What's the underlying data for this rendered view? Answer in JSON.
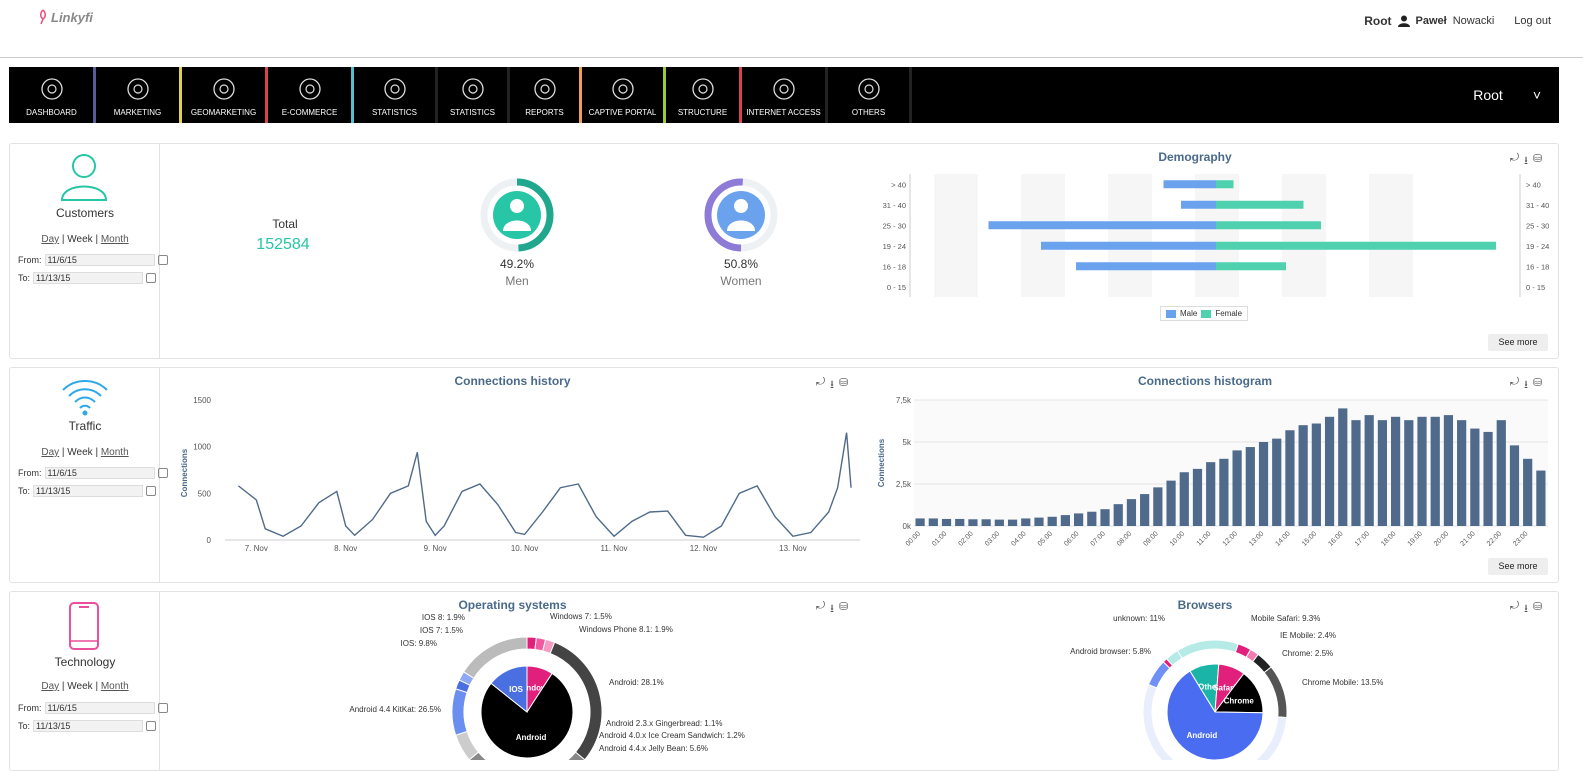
{
  "header": {
    "logo_text": "Linkyfi",
    "account": "Root",
    "user_first": "Paweł",
    "user_last": "Nowacki",
    "logout": "Log out"
  },
  "nav": {
    "items": [
      {
        "label": "DASHBOARD",
        "icon": "dashboard-icon",
        "color": "#5a5a9a"
      },
      {
        "label": "MARKETING",
        "icon": "target-icon",
        "color": "#e0d24a"
      },
      {
        "label": "GEOMARKETING",
        "icon": "globe-icon",
        "color": "#d9434d"
      },
      {
        "label": "E-COMMERCE",
        "icon": "shop-icon",
        "color": "#52c0d0"
      },
      {
        "label": "STATISTICS",
        "icon": "stats-icon",
        "color": "#222222"
      },
      {
        "label": "STATISTICS",
        "icon": "percent-icon",
        "color": "#222222"
      },
      {
        "label": "REPORTS",
        "icon": "reports-icon",
        "color": "#f0a050"
      },
      {
        "label": "CAPTIVE PORTAL",
        "icon": "cloud-icon",
        "color": "#9acd32"
      },
      {
        "label": "STRUCTURE",
        "icon": "users-icon",
        "color": "#d9434d"
      },
      {
        "label": "INTERNET ACCESS",
        "icon": "server-icon",
        "color": "#222222"
      },
      {
        "label": "OTHERS",
        "icon": "person-icon",
        "color": "#222222"
      }
    ],
    "account_select": "Root",
    "account_chevron": "˅"
  },
  "customers": {
    "title": "Customers",
    "period_day": "Day",
    "period_week": "Week",
    "period_month": "Month",
    "from_label": "From:",
    "from_value": "11/6/15",
    "to_label": "To:",
    "to_value": "11/13/15",
    "total_label": "Total",
    "total_value": "152584",
    "men_pct": "49.2%",
    "men_label": "Men",
    "men_fraction": 0.492,
    "women_pct": "50.8%",
    "women_label": "Women",
    "women_fraction": 0.508,
    "see_more": "See more"
  },
  "demography": {
    "title": "Demography",
    "legend_male": "Male",
    "legend_female": "Female",
    "male_color": "#6aa2ee",
    "female_color": "#4fd1b0"
  },
  "traffic": {
    "title": "Traffic",
    "period_day": "Day",
    "period_week": "Week",
    "period_month": "Month",
    "from_label": "From:",
    "from_value": "11/6/15",
    "to_label": "To:",
    "to_value": "11/13/15",
    "history_title": "Connections history",
    "histogram_title": "Connections histogram",
    "see_more": "See more"
  },
  "technology": {
    "title": "Technology",
    "period_day": "Day",
    "period_week": "Week",
    "period_month": "Month",
    "from_label": "From:",
    "from_value": "11/6/15",
    "to_label": "To:",
    "to_value": "11/13/15",
    "os_title": "Operating systems",
    "browsers_title": "Browsers"
  },
  "chart_data": [
    {
      "type": "bar",
      "title": "Demography",
      "orientation": "horizontal",
      "categories": [
        "> 40",
        "31 - 40",
        "25 - 30",
        "19 - 24",
        "16 - 18",
        "0 - 15"
      ],
      "series": [
        {
          "name": "Male",
          "values": [
            6,
            4,
            26,
            20,
            16,
            0
          ]
        },
        {
          "name": "Female",
          "values": [
            2,
            10,
            12,
            32,
            8,
            0
          ]
        }
      ]
    },
    {
      "type": "line",
      "title": "Connections history",
      "ylabel": "Connections",
      "ylim": [
        0,
        1500
      ],
      "yticks": [
        "0",
        "500",
        "1000",
        "1500"
      ],
      "xticks": [
        "7. Nov",
        "8. Nov",
        "9. Nov",
        "10. Nov",
        "11. Nov",
        "12. Nov",
        "13. Nov"
      ],
      "x": [
        6.8,
        7.0,
        7.1,
        7.3,
        7.5,
        7.7,
        7.9,
        8.0,
        8.1,
        8.3,
        8.5,
        8.7,
        8.8,
        8.9,
        9.0,
        9.1,
        9.3,
        9.5,
        9.7,
        9.9,
        10.0,
        10.2,
        10.4,
        10.6,
        10.8,
        11.0,
        11.2,
        11.4,
        11.6,
        11.8,
        12.0,
        12.2,
        12.4,
        12.6,
        12.8,
        13.0,
        13.2,
        13.4,
        13.5,
        13.6,
        13.65
      ],
      "values": [
        580,
        430,
        120,
        40,
        150,
        400,
        520,
        150,
        50,
        220,
        500,
        580,
        940,
        200,
        50,
        150,
        520,
        600,
        380,
        80,
        60,
        300,
        560,
        600,
        250,
        40,
        200,
        300,
        310,
        50,
        30,
        150,
        500,
        580,
        250,
        40,
        80,
        300,
        560,
        1150,
        560
      ]
    },
    {
      "type": "bar",
      "title": "Connections histogram",
      "ylabel": "Connections",
      "ylim": [
        0,
        7500
      ],
      "yticks": [
        "0k",
        "2,5k",
        "5k",
        "7,5k"
      ],
      "categories": [
        "00:00",
        "00:30",
        "01:00",
        "01:30",
        "02:00",
        "02:30",
        "03:00",
        "03:30",
        "04:00",
        "04:30",
        "05:00",
        "05:30",
        "06:00",
        "06:30",
        "07:00",
        "07:30",
        "08:00",
        "08:30",
        "09:00",
        "09:30",
        "10:00",
        "10:30",
        "11:00",
        "11:30",
        "12:00",
        "12:30",
        "13:00",
        "13:30",
        "14:00",
        "14:30",
        "15:00",
        "15:30",
        "16:00",
        "16:30",
        "17:00",
        "17:30",
        "18:00",
        "18:30",
        "19:00",
        "19:30",
        "20:00",
        "20:30",
        "21:00",
        "21:30",
        "22:00",
        "22:30",
        "23:00",
        "23:30"
      ],
      "xticks": [
        "00:00",
        "01:00",
        "02:00",
        "03:00",
        "04:00",
        "05:00",
        "06:00",
        "07:00",
        "08:00",
        "09:00",
        "10:00",
        "11:00",
        "12:00",
        "13:00",
        "14:00",
        "15:00",
        "16:00",
        "17:00",
        "18:00",
        "19:00",
        "20:00",
        "21:00",
        "22:00",
        "23:00"
      ],
      "values": [
        450,
        450,
        420,
        420,
        400,
        400,
        380,
        380,
        450,
        500,
        550,
        650,
        750,
        850,
        1000,
        1300,
        1600,
        1900,
        2300,
        2700,
        3200,
        3400,
        3800,
        4000,
        4500,
        4700,
        5000,
        5200,
        5700,
        6000,
        6100,
        6500,
        7000,
        6300,
        6600,
        6300,
        6500,
        6300,
        6500,
        6500,
        6600,
        6300,
        5800,
        5600,
        6300,
        4800,
        4000,
        3300
      ]
    },
    {
      "type": "pie",
      "title": "Operating systems",
      "inner": [
        {
          "name": "Android",
          "value": 75
        },
        {
          "name": "IOS",
          "value": 14
        },
        {
          "name": "Windows",
          "value": 9
        }
      ],
      "labels": [
        "IOS 8: 1.9%",
        "IOS 7: 1.5%",
        "IOS: 9.8%",
        "Windows 7: 1.5%",
        "Windows Phone 8.1: 1.9%",
        "Android: 28.1%",
        "Android 4.4 KitKat: 26.5%",
        "Android 2.3.x Gingerbread: 1.1%",
        "Android 4.0.x Ice Cream Sandwich: 1.2%",
        "Android 4.4.x Jelly Bean: 5.6%"
      ]
    },
    {
      "type": "pie",
      "title": "Browsers",
      "inner": [
        {
          "name": "Android",
          "value": 66
        },
        {
          "name": "Chrome",
          "value": 15
        },
        {
          "name": "Safari",
          "value": 9
        },
        {
          "name": "Other",
          "value": 10
        }
      ],
      "labels": [
        "unknown: 11%",
        "Mobile Safari: 9.3%",
        "IE Mobile: 2.4%",
        "Chrome: 2.5%",
        "Android browser: 5.8%",
        "Chrome Mobile: 13.5%"
      ]
    }
  ]
}
